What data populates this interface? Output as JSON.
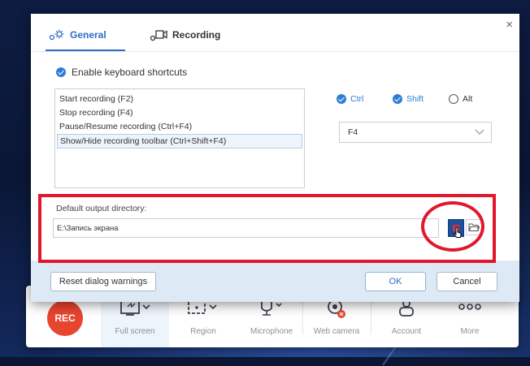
{
  "dialog": {
    "tabs": [
      {
        "label": "General",
        "icon": "gear-icon",
        "active": true
      },
      {
        "label": "Recording",
        "icon": "video-camera-icon",
        "active": false
      }
    ],
    "close_glyph": "×",
    "enable_shortcuts": {
      "label": "Enable keyboard shortcuts",
      "checked": true
    },
    "shortcuts": [
      {
        "label": "Start recording (F2)",
        "selected": false
      },
      {
        "label": "Stop recording (F4)",
        "selected": false
      },
      {
        "label": "Pause/Resume recording (Ctrl+F4)",
        "selected": false
      },
      {
        "label": "Show/Hide recording toolbar (Ctrl+Shift+F4)",
        "selected": true
      }
    ],
    "modifiers": {
      "ctrl": {
        "label": "Ctrl",
        "checked": true
      },
      "shift": {
        "label": "Shift",
        "checked": true
      },
      "alt": {
        "label": "Alt",
        "checked": false
      }
    },
    "key_select": {
      "value": "F4"
    },
    "output": {
      "label": "Default output directory:",
      "path": "E:\\Запись экрана"
    },
    "buttons": {
      "reset": "Reset dialog warnings",
      "ok": "OK",
      "cancel": "Cancel"
    }
  },
  "toolbar": {
    "rec_label": "REC",
    "items": [
      {
        "label": "Full screen",
        "icon": "fullscreen-icon"
      },
      {
        "label": "Region",
        "icon": "region-icon"
      },
      {
        "label": "Microphone",
        "icon": "microphone-icon"
      },
      {
        "label": "Web camera",
        "icon": "webcam-icon"
      },
      {
        "label": "Account",
        "icon": "account-icon"
      },
      {
        "label": "More",
        "icon": "more-icon"
      }
    ]
  },
  "colors": {
    "accent": "#2e6cc4",
    "rec": "#e8452e",
    "annotation": "#e3172b",
    "footer": "#dde9f4"
  }
}
